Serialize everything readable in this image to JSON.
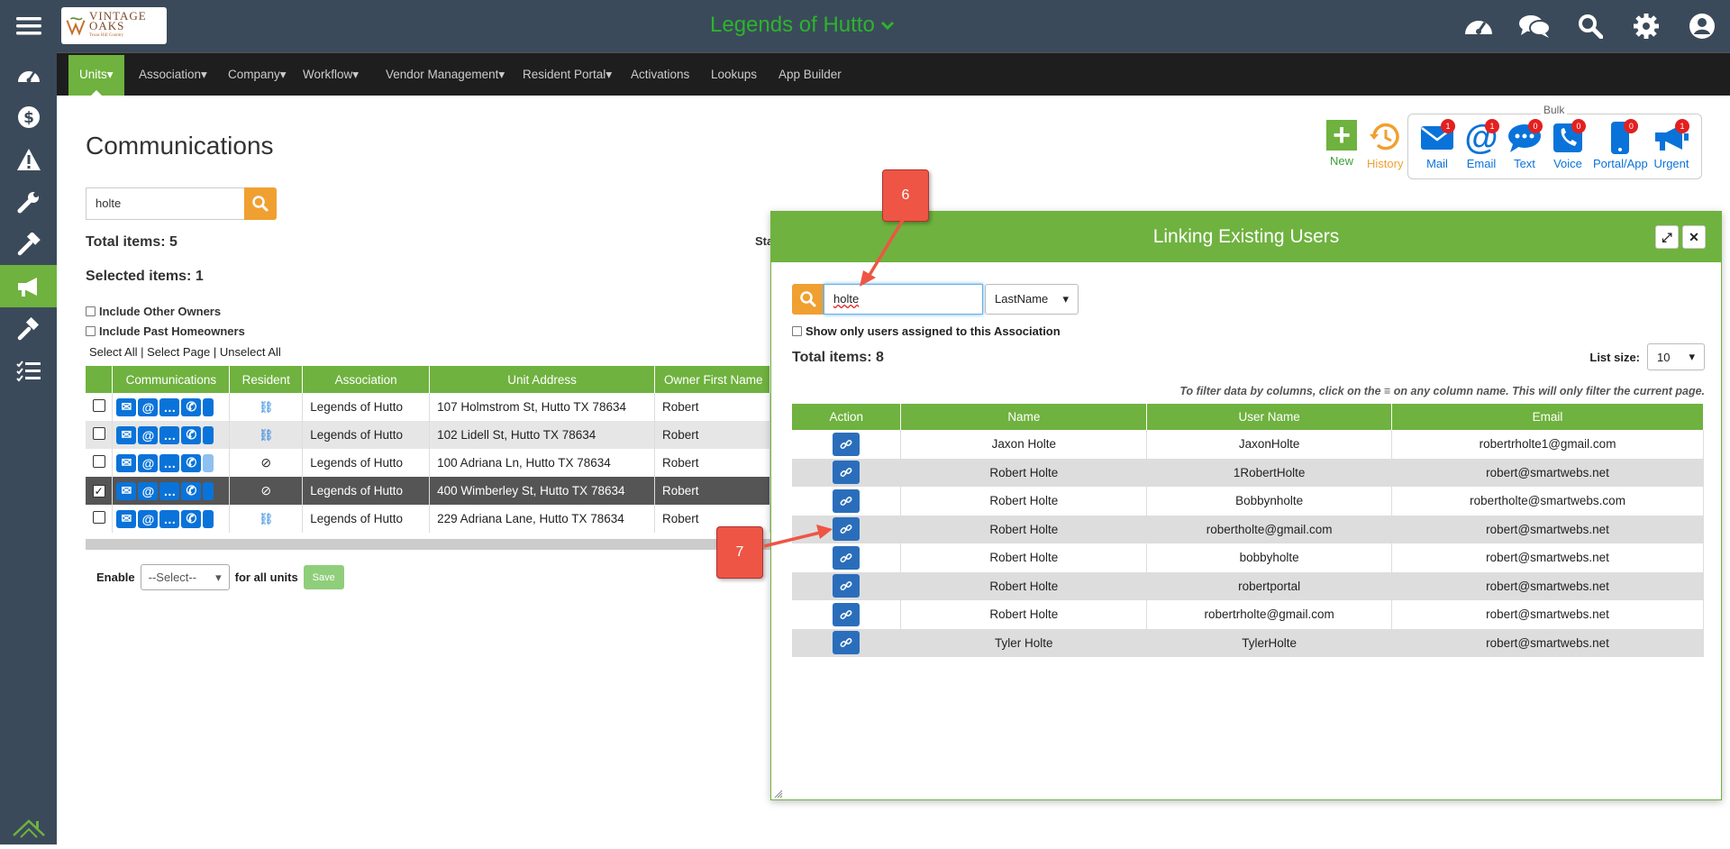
{
  "header": {
    "app_title": "Legends of Hutto",
    "logo_text": "VINTAGE OAKS",
    "logo_sub": "Texas Hill Country"
  },
  "nav": {
    "items": [
      "Units",
      "Association",
      "Company",
      "Workflow",
      "Vendor Management",
      "Resident Portal",
      "Activations",
      "Lookups",
      "App Builder"
    ]
  },
  "page": {
    "title": "Communications",
    "search_value": "holte",
    "total_items": "Total items: 5",
    "selected_items": "Selected items: 1",
    "status_label": "Sta",
    "include_other_owners": "Include Other Owners",
    "include_past_homeowners": "Include Past Homeowners",
    "select_all": "Select All",
    "select_page": "Select Page",
    "unselect_all": "Unselect All",
    "sep": "|",
    "enable_label": "Enable",
    "enable_select": "--Select--",
    "for_all_units": "for all units",
    "save_label": "Save"
  },
  "units_table": {
    "headers": [
      "Communications",
      "Resident",
      "Association",
      "Unit Address",
      "Owner First Name"
    ],
    "rows": [
      {
        "association": "Legends of Hutto",
        "address": "107 Holmstrom St, Hutto TX 78634",
        "owner": "Robert",
        "checked": false,
        "resident": "link"
      },
      {
        "association": "Legends of Hutto",
        "address": "102 Lidell St, Hutto TX 78634",
        "owner": "Robert",
        "checked": false,
        "resident": "link"
      },
      {
        "association": "Legends of Hutto",
        "address": "100 Adriana Ln, Hutto TX 78634",
        "owner": "Robert",
        "checked": false,
        "resident": "none"
      },
      {
        "association": "Legends of Hutto",
        "address": "400 Wimberley St, Hutto TX 78634",
        "owner": "Robert",
        "checked": true,
        "resident": "none"
      },
      {
        "association": "Legends of Hutto",
        "address": "229 Adriana Lane, Hutto TX 78634",
        "owner": "Robert",
        "checked": false,
        "resident": "link"
      }
    ]
  },
  "toolbar": {
    "new_label": "New",
    "history_label": "History",
    "bulk_label": "Bulk",
    "bulk": [
      {
        "label": "Mail",
        "count": "1"
      },
      {
        "label": "Email",
        "count": "1"
      },
      {
        "label": "Text",
        "count": "0"
      },
      {
        "label": "Voice",
        "count": "0"
      },
      {
        "label": "Portal/App",
        "count": "0"
      },
      {
        "label": "Urgent",
        "count": "1"
      }
    ]
  },
  "callouts": {
    "six": "6",
    "seven": "7"
  },
  "modal": {
    "title": "Linking Existing Users",
    "search_value": "holte",
    "search_field": "LastName",
    "assoc_only_label": "Show only users assigned to this Association",
    "total_items": "Total items: 8",
    "list_size_label": "List size:",
    "list_size": "10",
    "hint": "To filter data by columns, click on the ≡ on any column name. This will only filter the current page.",
    "headers": [
      "Action",
      "Name",
      "User Name",
      "Email"
    ],
    "rows": [
      {
        "name": "Jaxon Holte",
        "username": "JaxonHolte",
        "email": "robertrholte1@gmail.com"
      },
      {
        "name": "Robert Holte",
        "username": "1RobertHolte",
        "email": "robert@smartwebs.net"
      },
      {
        "name": "Robert Holte",
        "username": "Bobbynholte",
        "email": "robertholte@smartwebs.com"
      },
      {
        "name": "Robert Holte",
        "username": "robertholte@gmail.com",
        "email": "robert@smartwebs.net"
      },
      {
        "name": "Robert Holte",
        "username": "bobbyholte",
        "email": "robert@smartwebs.net"
      },
      {
        "name": "Robert Holte",
        "username": "robertportal",
        "email": "robert@smartwebs.net"
      },
      {
        "name": "Robert Holte",
        "username": "robertrholte@gmail.com",
        "email": "robert@smartwebs.net"
      },
      {
        "name": "Tyler Holte",
        "username": "TylerHolte",
        "email": "robert@smartwebs.net"
      }
    ]
  },
  "colors": {
    "brand_green": "#6fb23f",
    "title_green": "#2bb52b",
    "sidebar": "#3b4a5a",
    "orange": "#f0a030",
    "blue": "#0a73d9",
    "callout": "#ee5544"
  }
}
